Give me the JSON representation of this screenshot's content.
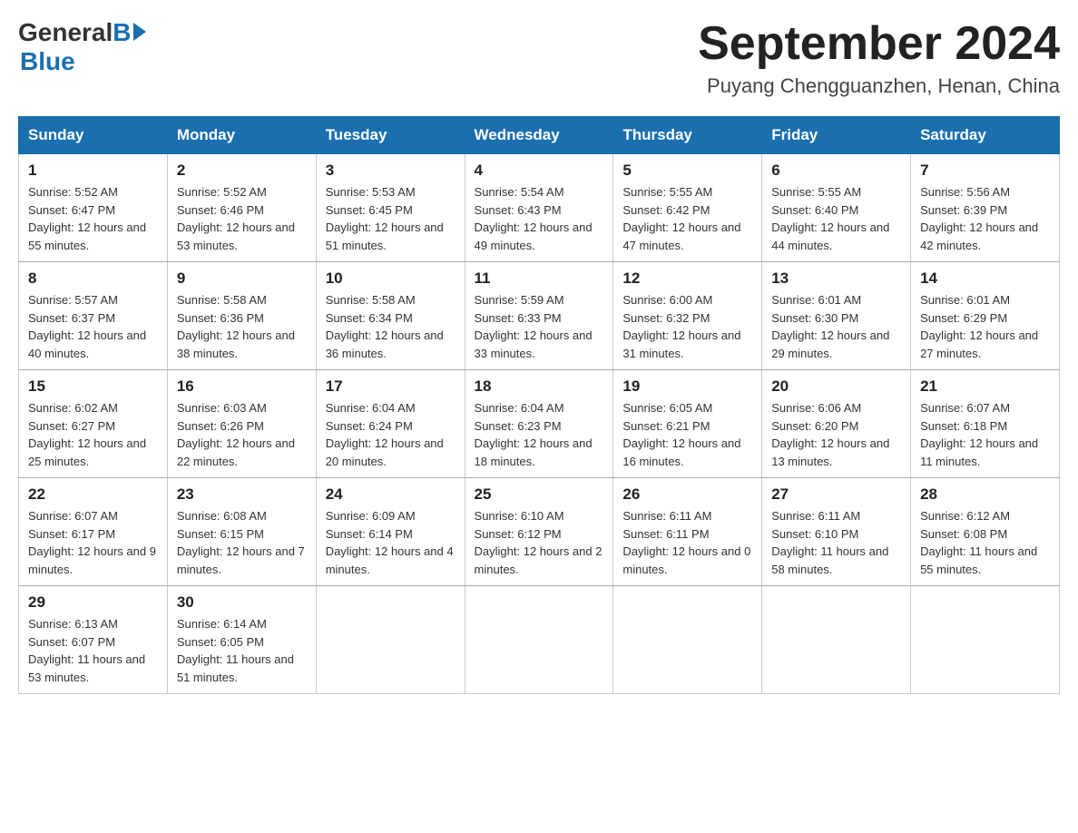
{
  "header": {
    "logo_general": "General",
    "logo_blue": "Blue",
    "month_title": "September 2024",
    "location": "Puyang Chengguanzhen, Henan, China"
  },
  "columns": [
    "Sunday",
    "Monday",
    "Tuesday",
    "Wednesday",
    "Thursday",
    "Friday",
    "Saturday"
  ],
  "weeks": [
    [
      {
        "day": "1",
        "sunrise": "Sunrise: 5:52 AM",
        "sunset": "Sunset: 6:47 PM",
        "daylight": "Daylight: 12 hours and 55 minutes."
      },
      {
        "day": "2",
        "sunrise": "Sunrise: 5:52 AM",
        "sunset": "Sunset: 6:46 PM",
        "daylight": "Daylight: 12 hours and 53 minutes."
      },
      {
        "day": "3",
        "sunrise": "Sunrise: 5:53 AM",
        "sunset": "Sunset: 6:45 PM",
        "daylight": "Daylight: 12 hours and 51 minutes."
      },
      {
        "day": "4",
        "sunrise": "Sunrise: 5:54 AM",
        "sunset": "Sunset: 6:43 PM",
        "daylight": "Daylight: 12 hours and 49 minutes."
      },
      {
        "day": "5",
        "sunrise": "Sunrise: 5:55 AM",
        "sunset": "Sunset: 6:42 PM",
        "daylight": "Daylight: 12 hours and 47 minutes."
      },
      {
        "day": "6",
        "sunrise": "Sunrise: 5:55 AM",
        "sunset": "Sunset: 6:40 PM",
        "daylight": "Daylight: 12 hours and 44 minutes."
      },
      {
        "day": "7",
        "sunrise": "Sunrise: 5:56 AM",
        "sunset": "Sunset: 6:39 PM",
        "daylight": "Daylight: 12 hours and 42 minutes."
      }
    ],
    [
      {
        "day": "8",
        "sunrise": "Sunrise: 5:57 AM",
        "sunset": "Sunset: 6:37 PM",
        "daylight": "Daylight: 12 hours and 40 minutes."
      },
      {
        "day": "9",
        "sunrise": "Sunrise: 5:58 AM",
        "sunset": "Sunset: 6:36 PM",
        "daylight": "Daylight: 12 hours and 38 minutes."
      },
      {
        "day": "10",
        "sunrise": "Sunrise: 5:58 AM",
        "sunset": "Sunset: 6:34 PM",
        "daylight": "Daylight: 12 hours and 36 minutes."
      },
      {
        "day": "11",
        "sunrise": "Sunrise: 5:59 AM",
        "sunset": "Sunset: 6:33 PM",
        "daylight": "Daylight: 12 hours and 33 minutes."
      },
      {
        "day": "12",
        "sunrise": "Sunrise: 6:00 AM",
        "sunset": "Sunset: 6:32 PM",
        "daylight": "Daylight: 12 hours and 31 minutes."
      },
      {
        "day": "13",
        "sunrise": "Sunrise: 6:01 AM",
        "sunset": "Sunset: 6:30 PM",
        "daylight": "Daylight: 12 hours and 29 minutes."
      },
      {
        "day": "14",
        "sunrise": "Sunrise: 6:01 AM",
        "sunset": "Sunset: 6:29 PM",
        "daylight": "Daylight: 12 hours and 27 minutes."
      }
    ],
    [
      {
        "day": "15",
        "sunrise": "Sunrise: 6:02 AM",
        "sunset": "Sunset: 6:27 PM",
        "daylight": "Daylight: 12 hours and 25 minutes."
      },
      {
        "day": "16",
        "sunrise": "Sunrise: 6:03 AM",
        "sunset": "Sunset: 6:26 PM",
        "daylight": "Daylight: 12 hours and 22 minutes."
      },
      {
        "day": "17",
        "sunrise": "Sunrise: 6:04 AM",
        "sunset": "Sunset: 6:24 PM",
        "daylight": "Daylight: 12 hours and 20 minutes."
      },
      {
        "day": "18",
        "sunrise": "Sunrise: 6:04 AM",
        "sunset": "Sunset: 6:23 PM",
        "daylight": "Daylight: 12 hours and 18 minutes."
      },
      {
        "day": "19",
        "sunrise": "Sunrise: 6:05 AM",
        "sunset": "Sunset: 6:21 PM",
        "daylight": "Daylight: 12 hours and 16 minutes."
      },
      {
        "day": "20",
        "sunrise": "Sunrise: 6:06 AM",
        "sunset": "Sunset: 6:20 PM",
        "daylight": "Daylight: 12 hours and 13 minutes."
      },
      {
        "day": "21",
        "sunrise": "Sunrise: 6:07 AM",
        "sunset": "Sunset: 6:18 PM",
        "daylight": "Daylight: 12 hours and 11 minutes."
      }
    ],
    [
      {
        "day": "22",
        "sunrise": "Sunrise: 6:07 AM",
        "sunset": "Sunset: 6:17 PM",
        "daylight": "Daylight: 12 hours and 9 minutes."
      },
      {
        "day": "23",
        "sunrise": "Sunrise: 6:08 AM",
        "sunset": "Sunset: 6:15 PM",
        "daylight": "Daylight: 12 hours and 7 minutes."
      },
      {
        "day": "24",
        "sunrise": "Sunrise: 6:09 AM",
        "sunset": "Sunset: 6:14 PM",
        "daylight": "Daylight: 12 hours and 4 minutes."
      },
      {
        "day": "25",
        "sunrise": "Sunrise: 6:10 AM",
        "sunset": "Sunset: 6:12 PM",
        "daylight": "Daylight: 12 hours and 2 minutes."
      },
      {
        "day": "26",
        "sunrise": "Sunrise: 6:11 AM",
        "sunset": "Sunset: 6:11 PM",
        "daylight": "Daylight: 12 hours and 0 minutes."
      },
      {
        "day": "27",
        "sunrise": "Sunrise: 6:11 AM",
        "sunset": "Sunset: 6:10 PM",
        "daylight": "Daylight: 11 hours and 58 minutes."
      },
      {
        "day": "28",
        "sunrise": "Sunrise: 6:12 AM",
        "sunset": "Sunset: 6:08 PM",
        "daylight": "Daylight: 11 hours and 55 minutes."
      }
    ],
    [
      {
        "day": "29",
        "sunrise": "Sunrise: 6:13 AM",
        "sunset": "Sunset: 6:07 PM",
        "daylight": "Daylight: 11 hours and 53 minutes."
      },
      {
        "day": "30",
        "sunrise": "Sunrise: 6:14 AM",
        "sunset": "Sunset: 6:05 PM",
        "daylight": "Daylight: 11 hours and 51 minutes."
      },
      null,
      null,
      null,
      null,
      null
    ]
  ]
}
